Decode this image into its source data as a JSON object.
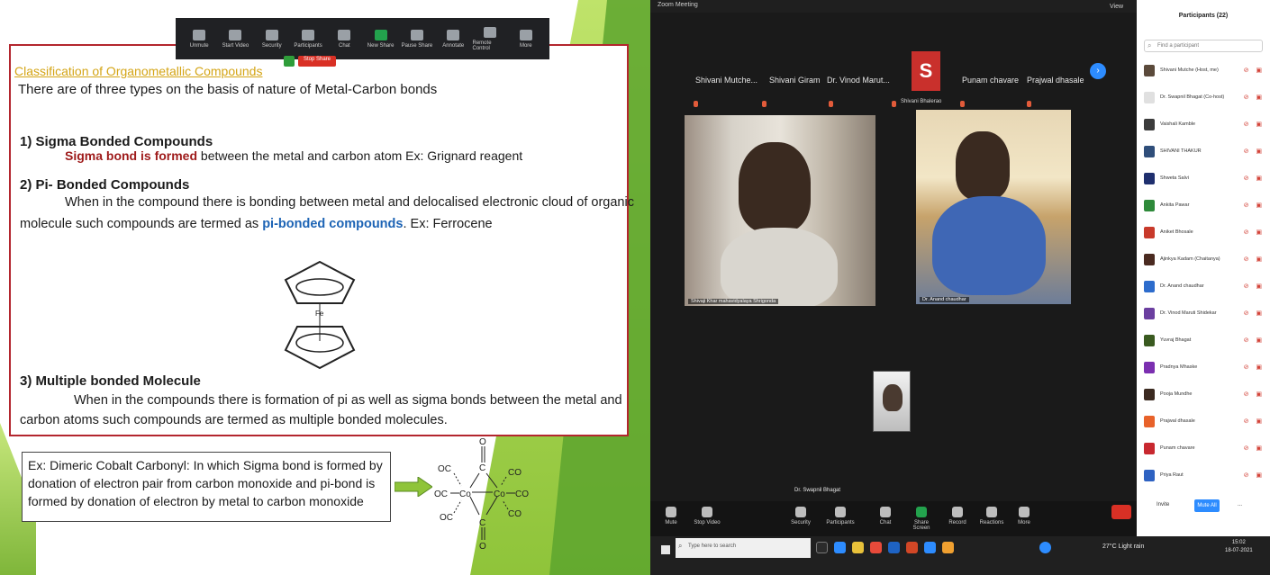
{
  "slide": {
    "toolbar": {
      "items": [
        "Unmute",
        "Start Video",
        "Security",
        "Participants",
        "Chat",
        "New Share",
        "Pause Share",
        "Annotate",
        "Remote Control",
        "More"
      ]
    },
    "share_id": "",
    "stop_share": "Stop Share",
    "title": "Classification of Organometallic Compounds",
    "intro": "There are of three types on the basis of nature of Metal-Carbon bonds",
    "sections": [
      {
        "heading": "1) Sigma Bonded Compounds",
        "lines": [
          {
            "highlight": "Sigma bond is formed",
            "rest": " between the metal and carbon atom    Ex: Grignard reagent"
          }
        ]
      },
      {
        "heading": "2) Pi- Bonded Compounds",
        "line1": "When in the compound there is bonding between metal and delocalised electronic cloud of organic",
        "line2_pre": "molecule such compounds are termed as ",
        "line2_highlight": "pi-bonded compounds",
        "line2_post": ".  Ex: Ferrocene"
      },
      {
        "heading": "3) Multiple bonded Molecule",
        "line1": "When in the compounds there is formation of pi as well as sigma bonds between the metal and",
        "line2": "carbon atoms such compounds are termed as multiple bonded molecules."
      }
    ],
    "ferrocene_metal": "Fe",
    "example_box": [
      "Ex: Dimeric Cobalt Carbonyl: In which Sigma bond is formed by",
      "donation of electron pair from carbon monoxide and pi-bond is",
      "formed by donation of electron by metal to carbon monoxide"
    ],
    "cobalt_labels": {
      "oc_tl": "OC",
      "co_tr": "CO",
      "oc_ml": "OC",
      "co_mr": "CO",
      "oc_bl": "OC",
      "co_br": "CO",
      "o_top": "O",
      "o_bot": "O",
      "co1": "Co",
      "co2": "Co",
      "c_top": "C",
      "c_bot": "C"
    },
    "colors": {
      "accent_title": "#d4a516",
      "border": "#b3262e",
      "sigma_red": "#9e1a1a",
      "pi_blue": "#1d64b5",
      "green": "#5da52e"
    }
  },
  "zoom": {
    "window_title": "Zoom Meeting",
    "view_label": "View",
    "strip_names": [
      "Shivani Mutche...",
      "Shivani Giram",
      "Dr. Vinod Marut...",
      "Punam chavare",
      "Prajwal dhasale"
    ],
    "s_avatar_letter": "S",
    "s_avatar_name": "Shivani Bhalerao",
    "tile1_label": "Shivaji Khar mahavidyalaya Shrigonda",
    "tile2_label": "Dr. Anand chaudhar",
    "tile3_label": "Dr. Swapnil Bhagat",
    "controls": [
      "Mute",
      "Stop Video",
      "Security",
      "Participants",
      "Chat",
      "Share Screen",
      "Record",
      "Reactions",
      "More"
    ],
    "taskbar": {
      "search_placeholder": "Type here to search",
      "weather": "27°C Light rain",
      "time": "15:02",
      "date": "18-07-2021"
    }
  },
  "participants": {
    "title": "Participants (22)",
    "search_placeholder": "Find a participant",
    "list": [
      {
        "name": "Shivani Mutche (Host, me)",
        "color": "#5b4a3b"
      },
      {
        "name": "Dr. Swapnil Bhagat (Co-host)",
        "color": "#e0e0e0"
      },
      {
        "name": "Vaishali Kamble",
        "color": "#3b3b3b"
      },
      {
        "name": "SHIVANI THAKUR",
        "color": "#2f4e7a"
      },
      {
        "name": "Shweta Salvi",
        "color": "#1f2f6e"
      },
      {
        "name": "Ankita Pawar",
        "color": "#2e8a3a"
      },
      {
        "name": "Aniket Bhosale",
        "color": "#c83a2b"
      },
      {
        "name": "Ajinkya Kadam (Chaitanya)",
        "color": "#4a2a20"
      },
      {
        "name": "Dr. Anand chaudhar",
        "color": "#2d6ccc"
      },
      {
        "name": "Dr. Vinod Maruti Shidekar",
        "color": "#6b3fa0"
      },
      {
        "name": "Yuvraj Bhagat",
        "color": "#3a5a20"
      },
      {
        "name": "Pradnya Mhaske",
        "color": "#7b2fb0"
      },
      {
        "name": "Pooja Mundhe",
        "color": "#3b2a20"
      },
      {
        "name": "Prajwal dhasale",
        "color": "#e8622a"
      },
      {
        "name": "Punam chavare",
        "color": "#c8282f"
      },
      {
        "name": "Priya Raut",
        "color": "#2e62c2"
      }
    ],
    "invite": "Invite",
    "mute_all": "Mute All",
    "more": "..."
  }
}
